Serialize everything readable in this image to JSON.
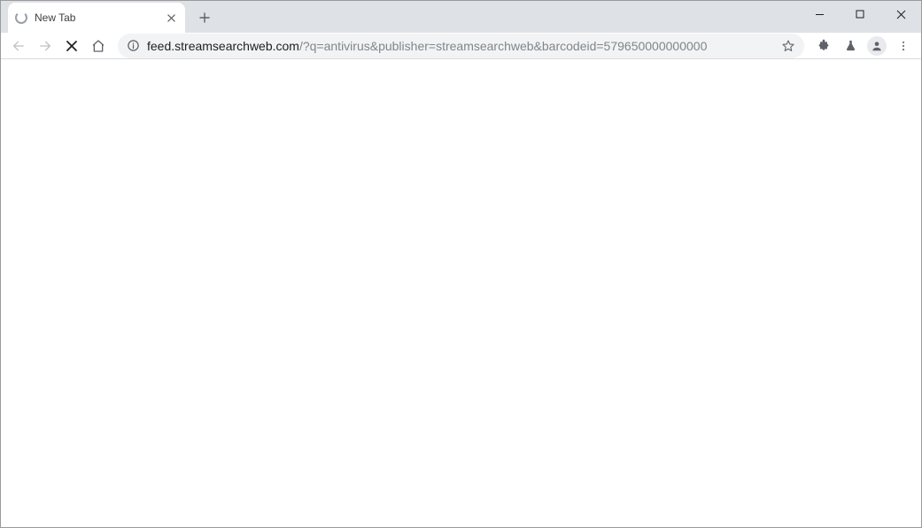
{
  "window": {
    "controls": {
      "minimize": "minimize",
      "maximize": "maximize",
      "close": "close"
    }
  },
  "tabs": [
    {
      "title": "New Tab",
      "loading": true
    }
  ],
  "toolbar": {
    "back_enabled": false,
    "forward_enabled": false,
    "loading": true
  },
  "omnibox": {
    "host": "feed.streamsearchweb.com",
    "path": "/?q=antivirus&publisher=streamsearchweb&barcodeid=579650000000000"
  }
}
